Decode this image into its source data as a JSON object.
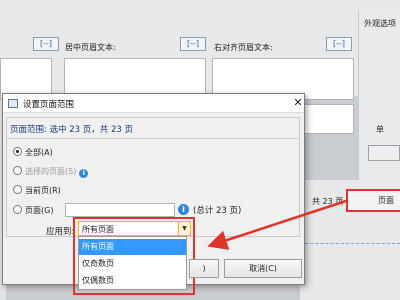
{
  "background": {
    "right_panel_title": "外观选项",
    "center_header_label": "居中页眉文本:",
    "right_header_label": "右对齐页眉文本:",
    "right_small_label": "单",
    "format_button_label": "[--]",
    "pages_text": "共 23 页",
    "page_button_label": "页面"
  },
  "dialog": {
    "title": "设置页面范围",
    "close_label": "✕",
    "page_range_text": "页面范围: 选中 23 页，共 23 页",
    "options": [
      {
        "label": "全部(A)",
        "checked": true,
        "disabled": false
      },
      {
        "label": "选择的页面(S)",
        "checked": false,
        "disabled": true
      },
      {
        "label": "当前页(R)",
        "checked": false,
        "disabled": false
      },
      {
        "label": "页面(G)",
        "checked": false,
        "disabled": false
      }
    ],
    "pages_input_value": "",
    "total_text": "(总计 23 页)",
    "apply_label": "应用到:",
    "select_value": "所有页面",
    "dropdown_options": [
      "所有页面",
      "仅奇数页",
      "仅偶数页"
    ],
    "dropdown_selected_index": 0,
    "cancel_label": "取消(C)",
    "ok_label": ")"
  },
  "colors": {
    "highlight_red": "#e0332a",
    "selection_blue": "#3399ff",
    "info_blue": "#2f86d6"
  }
}
